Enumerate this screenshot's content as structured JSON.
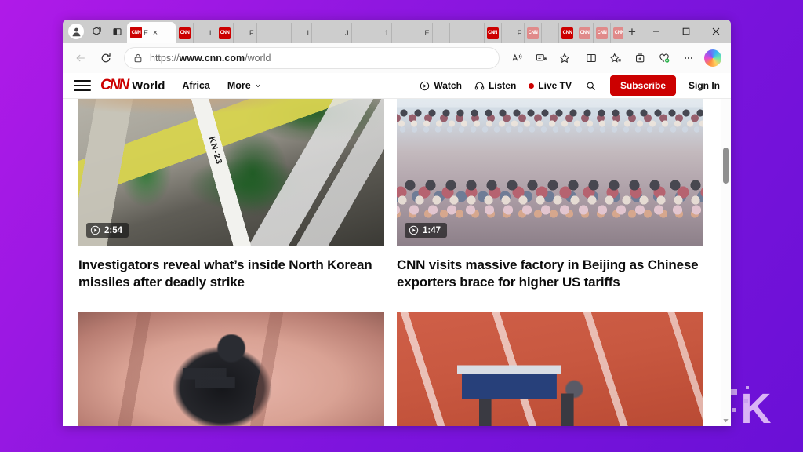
{
  "window": {
    "profile_icon": "profile-avatar-icon",
    "workspaces_icon": "workspaces-icon",
    "tab_actions_icon": "tab-actions-icon",
    "new_tab_label": "+",
    "controls": {
      "minimize": "minimize-icon",
      "maximize": "maximize-icon",
      "close": "close-icon"
    }
  },
  "tabs": {
    "active_index": 0,
    "items": [
      {
        "favicon": "cnn",
        "title": "E",
        "active": true,
        "close_label": "×"
      },
      {
        "favicon": "cnn",
        "title": "",
        "active": false
      },
      {
        "favicon": "blank",
        "title": "L",
        "active": false
      },
      {
        "favicon": "cnn",
        "title": "",
        "active": false
      },
      {
        "favicon": "blank",
        "title": "F",
        "active": false
      },
      {
        "favicon": "blank",
        "title": "",
        "active": false
      },
      {
        "favicon": "blank",
        "title": "",
        "active": false
      },
      {
        "favicon": "blank",
        "title": "I",
        "active": false
      },
      {
        "favicon": "blank",
        "title": "",
        "active": false
      },
      {
        "favicon": "blank",
        "title": "J",
        "active": false
      },
      {
        "favicon": "blank",
        "title": "",
        "active": false
      },
      {
        "favicon": "blank",
        "title": "1",
        "active": false
      },
      {
        "favicon": "blank",
        "title": "",
        "active": false
      },
      {
        "favicon": "blank",
        "title": "E",
        "active": false
      },
      {
        "favicon": "blank",
        "title": "",
        "active": false
      },
      {
        "favicon": "blank",
        "title": "",
        "active": false
      },
      {
        "favicon": "blank",
        "title": "",
        "active": false
      },
      {
        "favicon": "cnn",
        "title": "",
        "active": false
      },
      {
        "favicon": "blank",
        "title": "F",
        "active": false
      },
      {
        "favicon": "cnn-dim",
        "title": "",
        "active": false
      },
      {
        "favicon": "blank",
        "title": "",
        "active": false
      },
      {
        "favicon": "cnn",
        "title": "",
        "active": false
      },
      {
        "favicon": "cnn-dim",
        "title": "",
        "active": false
      },
      {
        "favicon": "cnn-dim",
        "title": "",
        "active": false
      },
      {
        "favicon": "cnn-dim",
        "title": "",
        "active": false
      },
      {
        "favicon": "cnn-dim",
        "title": "",
        "active": false
      },
      {
        "favicon": "cnn-dim",
        "title": "",
        "active": false
      },
      {
        "favicon": "cnn-dim",
        "title": "",
        "active": false
      },
      {
        "favicon": "cnn-dim",
        "title": "",
        "active": false
      }
    ],
    "favicon_label": "CNN"
  },
  "address_bar": {
    "back_icon": "back-arrow-icon",
    "refresh_icon": "refresh-icon",
    "lock_icon": "lock-icon",
    "url_prefix": "https://",
    "url_domain": "www.cnn.com",
    "url_path": "/world",
    "read_aloud_icon": "read-aloud-icon",
    "immersive_reader_icon": "immersive-reader-icon",
    "favorite_icon": "favorite-star-icon",
    "split_screen_icon": "split-screen-icon",
    "favorites_list_icon": "favorites-list-icon",
    "collections_icon": "collections-icon",
    "browser_essentials_icon": "browser-essentials-icon",
    "settings_icon": "settings-more-icon",
    "copilot_icon": "copilot-icon"
  },
  "site_nav": {
    "menu_icon": "hamburger-menu-icon",
    "logo": "CNN",
    "section": "World",
    "links": [
      {
        "label": "Africa",
        "has_chevron": false
      },
      {
        "label": "More",
        "has_chevron": true
      }
    ],
    "utilities": [
      {
        "label": "Watch",
        "icon": "play-circle-icon"
      },
      {
        "label": "Listen",
        "icon": "headphones-icon"
      },
      {
        "label": "Live TV",
        "icon": "live-dot-icon"
      }
    ],
    "search_icon": "search-icon",
    "subscribe_label": "Subscribe",
    "signin_label": "Sign In",
    "accent_color": "#cc0000"
  },
  "articles": [
    {
      "art": "art-missiles",
      "duration": "2:54",
      "play_icon": "play-circle-icon",
      "headline": "Investigators reveal what’s inside North Korean missiles after deadly strike",
      "overlay_label": "KN-23"
    },
    {
      "art": "art-market",
      "duration": "1:47",
      "play_icon": "play-circle-icon",
      "headline": "CNN visits massive factory in Beijing as Chinese exporters brace for higher US tariffs",
      "overlay_label": ""
    },
    {
      "art": "art-beetle",
      "duration": "",
      "play_icon": "",
      "headline": "",
      "overlay_label": ""
    },
    {
      "art": "art-robot",
      "duration": "",
      "play_icon": "",
      "headline": "",
      "overlay_label": ""
    }
  ],
  "scrollbar": {
    "thumb_name": "scroll-thumb",
    "down_arrow_icon": "scroll-down-arrow-icon"
  },
  "watermark": {
    "letter": "K",
    "color": "#d9b3f5"
  },
  "background": {
    "color": "#8f17e0"
  }
}
